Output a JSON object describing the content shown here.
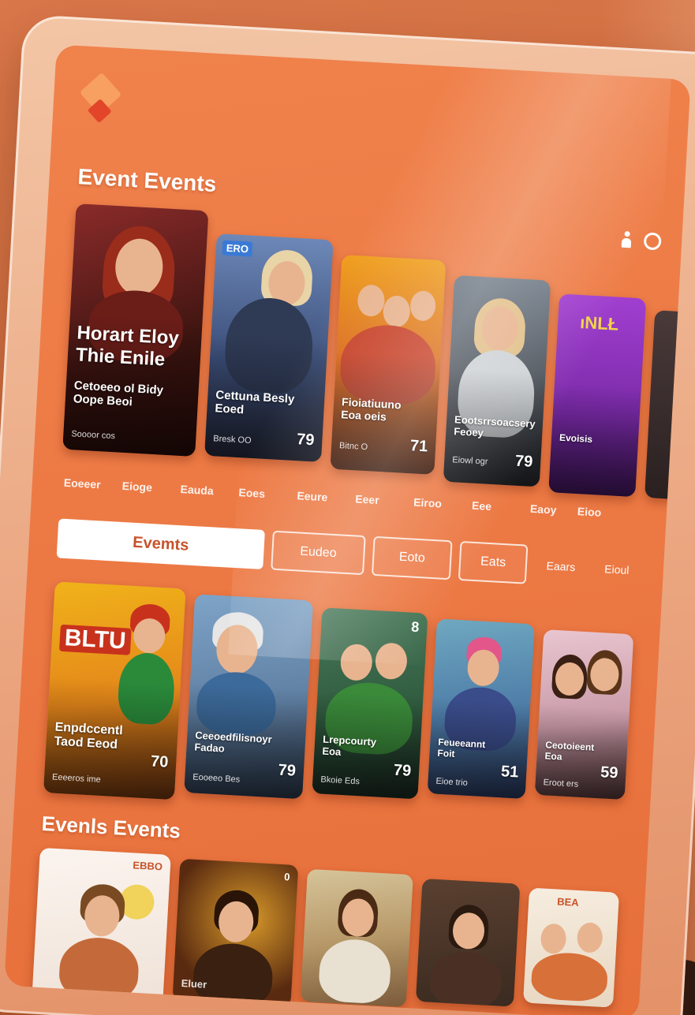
{
  "sections": {
    "featured_title": "Event Events",
    "bottom_title": "Evenls Events"
  },
  "featured_cards": [
    {
      "title": "Horart Eloy Thie Enile",
      "subtitle": "Cetoeeo ol Bidy Oope Beoi",
      "meta": "Soooor cos",
      "number": ""
    },
    {
      "title": "Cettuna Besly Eoed",
      "subtitle": "",
      "meta": "Bresk OO",
      "number": "79",
      "badge": "ERO"
    },
    {
      "title": "Fioiatiuuno Eoa oeis",
      "subtitle": "",
      "meta": "Bitnc O",
      "number": "71"
    },
    {
      "title": "Eootsrrsoacsery Feoey",
      "subtitle": "",
      "meta": "Eiowl ogr",
      "number": "79"
    },
    {
      "title": "Evoisis",
      "subtitle": "",
      "meta": "",
      "number": ""
    }
  ],
  "categories": [
    "Eoeeer",
    "Eioge",
    "Eauda",
    "Eoes",
    "Eeure",
    "Eeer",
    "Eiroo",
    "Eee",
    "Eaoy",
    "Eioo"
  ],
  "tabs": [
    {
      "label": "Evemts",
      "active": true
    },
    {
      "label": "Eudeo",
      "active": false
    },
    {
      "label": "Eoto",
      "active": false
    },
    {
      "label": "Eats",
      "active": false
    },
    {
      "label": "Eaars",
      "active": false
    },
    {
      "label": "Eioul",
      "active": false
    }
  ],
  "event_cards": [
    {
      "title": "Enpdccentl Taod Eeod",
      "meta": "Eeeeros ime",
      "number": "70",
      "poster_text": "BLTU"
    },
    {
      "title": "Ceeoedfilisnoyr Fadao",
      "meta": "Eooeeo Bes",
      "number": "79"
    },
    {
      "title": "Lrepcourty Eoa",
      "meta": "Bkoie Eds",
      "number": "79",
      "badge": "8"
    },
    {
      "title": "Feueeannt Foit",
      "meta": "Eioe trio",
      "number": "51"
    },
    {
      "title": "Ceotoieent Eoa",
      "meta": "Eroot ers",
      "number": "59"
    }
  ],
  "bottom_cards": [
    {
      "badge": "EBBO"
    },
    {
      "badge": "0",
      "caption": "Eluer"
    },
    {},
    {},
    {
      "badge": "BEA"
    }
  ],
  "colors": {
    "screen": "#ec7843",
    "frame": "#f3c6a6",
    "accent": "#c7532a"
  }
}
